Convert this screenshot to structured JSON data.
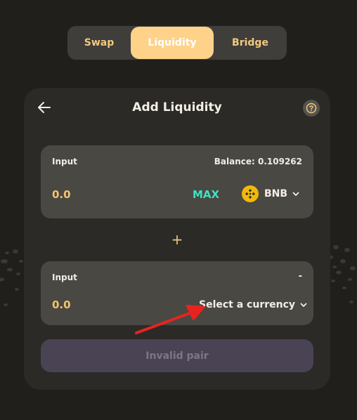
{
  "nav": {
    "tabs": [
      {
        "label": "Swap",
        "active": false
      },
      {
        "label": "Liquidity",
        "active": true
      },
      {
        "label": "Bridge",
        "active": false
      }
    ]
  },
  "card": {
    "title": "Add Liquidity",
    "back_icon": "arrow-left-icon",
    "help_icon": "question-circle-icon"
  },
  "input1": {
    "label": "Input",
    "balance": "Balance: 0.109262",
    "amount": "0.0",
    "max_label": "MAX",
    "token_symbol": "BNB",
    "token_icon": "bnb-logo-icon"
  },
  "plus_symbol": "+",
  "input2": {
    "label": "Input",
    "balance": "-",
    "amount": "0.0",
    "select_label": "Select a currency"
  },
  "submit": {
    "label": "Invalid pair",
    "disabled": true
  },
  "colors": {
    "accent": "#ffd28a",
    "amount": "#f3c370",
    "max": "#3ee0c2",
    "bnb": "#f0b90b",
    "annotation_arrow": "#e8231f"
  }
}
